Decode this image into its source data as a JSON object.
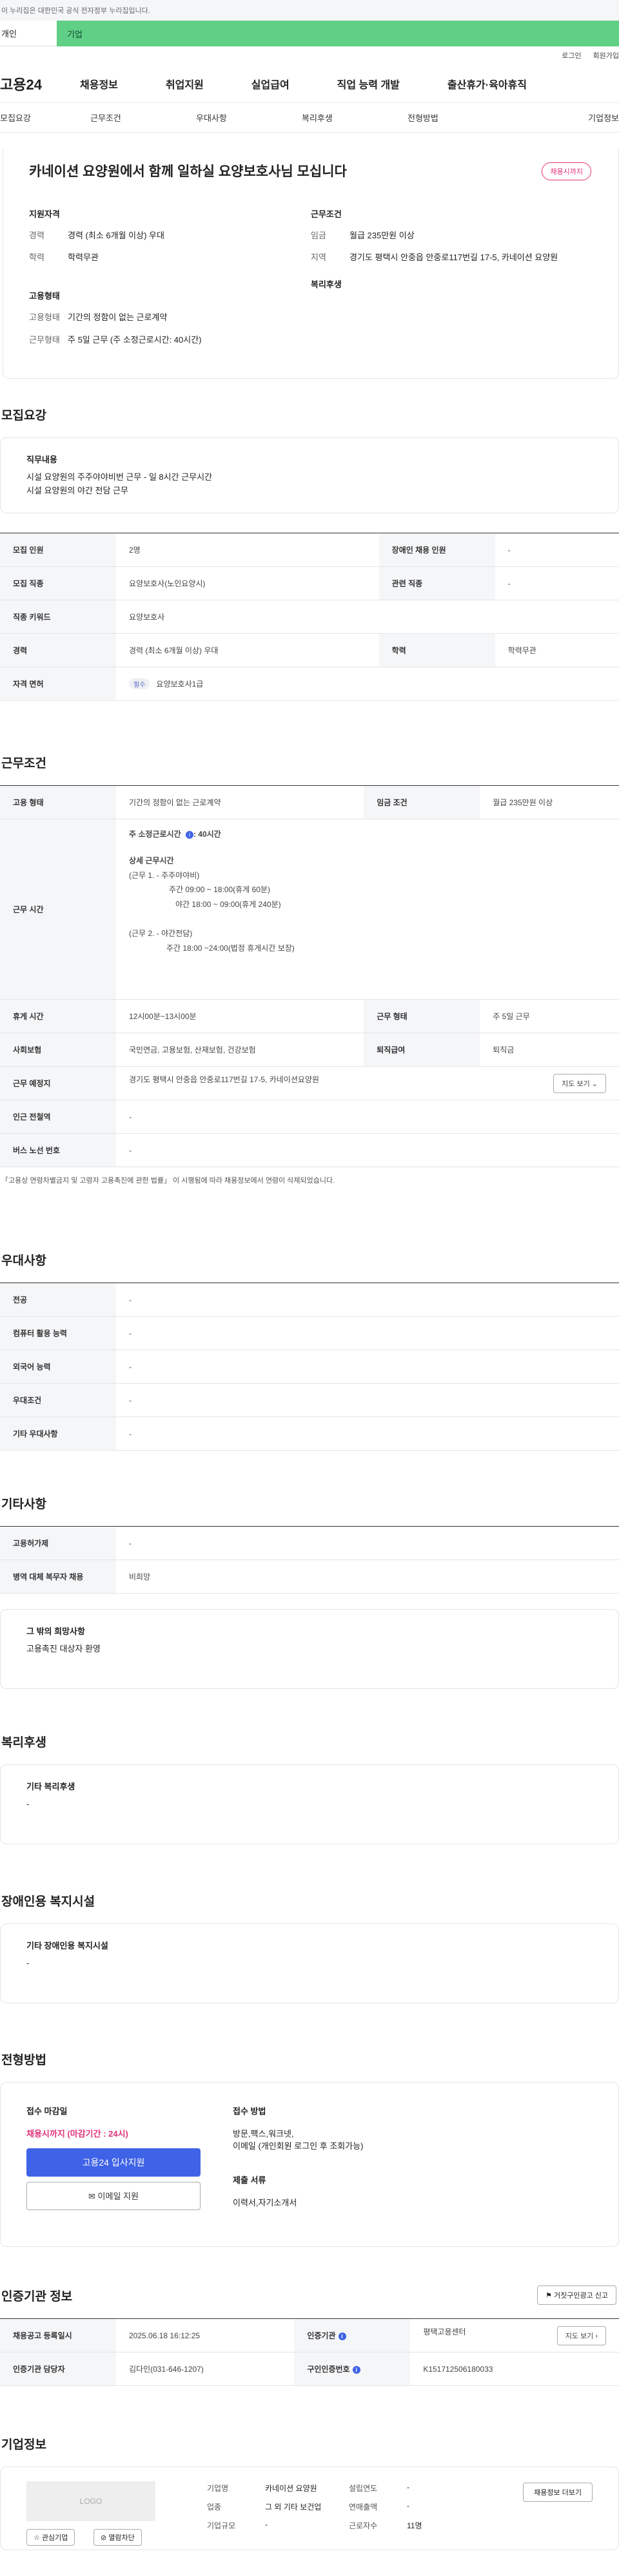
{
  "gov_banner": "이 누리집은 대한민국 공식 전자정부 누리집입니다.",
  "tabs": {
    "individual": "개인",
    "corporate": "기업"
  },
  "util": {
    "login": "로그인",
    "join": "회원가입"
  },
  "gnb": {
    "logo": "고용24",
    "items": [
      "채용정보",
      "취업지원",
      "실업급여",
      "직업 능력 개발",
      "출산휴가·육아휴직"
    ]
  },
  "anchors": [
    "모집요강",
    "근무조건",
    "우대사항",
    "복리후생",
    "전형방법",
    "기업정보"
  ],
  "summary": {
    "title": "카네이션 요양원에서 함께 일하실 요양보호사님 모십니다",
    "badge": "채용시까지",
    "qual_h": "지원자격",
    "career_k": "경력",
    "career_v": "경력 (최소 6개월 이상) 우대",
    "edu_k": "학력",
    "edu_v": "학력무관",
    "cond_h": "근무조건",
    "wage_k": "임금",
    "wage_v": "월급 235만원 이상",
    "region_k": "지역",
    "region_v": "경기도 평택시 안중읍 안중로117번길 17-5, 카네이션 요양원",
    "emp_h": "고용형태",
    "emp_k": "고용형태",
    "emp_v": "기간의 정함이 없는 근로계약",
    "work_k": "근무형태",
    "work_v": "주 5일 근무 (주 소정근로시간: 40시간)",
    "welfare_h": "복리후생"
  },
  "recruit": {
    "title": "모집요강",
    "duty_h": "직무내용",
    "duty_lines": [
      "시설 요양원의 주주야야비번 근무 - 일 8시간 근무시간",
      "시설 요양원의 야간 전담 근무"
    ],
    "rows": [
      [
        "모집 인원",
        "2명",
        "장애인 채용 인원",
        "-"
      ],
      [
        "모집 직종",
        "요양보호사(노인요양시)",
        "관련 직종",
        "-"
      ],
      [
        "직종 키워드",
        "요양보호사",
        "",
        ""
      ],
      [
        "경력",
        "경력 (최소 6개월 이상) 우대",
        "학력",
        "학력무관"
      ]
    ],
    "license_k": "자격 면허",
    "license_pill": "필수",
    "license_v": "요양보호사1급"
  },
  "work": {
    "title": "근무조건",
    "emp_k": "고용 형태",
    "emp_v": "기간의 정함이 없는 근로계약",
    "wage_k": "임금 조건",
    "wage_v": "월급 235만원 이상",
    "hours_k": "근무 시간",
    "hours_main": "주 소정근로시간",
    "hours_main_v": ": 40시간",
    "detail_h": "상세 근무시간",
    "detail_lines": [
      "(근무 1. - 주주야야비)",
      "주간 09:00 ~ 18:00(휴게 60분)",
      "야간 18:00 ~ 09:00(휴게 240분)",
      "",
      "(근무 2. - 야간전담)",
      "주간 18:00 ~24:00(법정 휴게시간 보장)"
    ],
    "break_k": "휴게 시간",
    "break_v": "12시00분~13시00분",
    "form_k": "근무 형태",
    "form_v": "주 5일 근무",
    "ins_k": "사회보험",
    "ins_v": "국민연금, 고용보험, 산재보험, 건강보험",
    "sev_k": "퇴직급여",
    "sev_v": "퇴직금",
    "place_k": "근무 예정지",
    "place_v": "경기도 평택시 안중읍 안중로117번길 17-5, 카네이션요양원",
    "map_btn": "지도 보기",
    "subway_k": "인근 전철역",
    "subway_v": "-",
    "bus_k": "버스 노선 번호",
    "bus_v": "-",
    "note": "「고용상 연령차별금지 및 고령자 고용촉진에 관한 법률」 이 시행됨에 따라 채용정보에서 연령이 삭제되었습니다."
  },
  "pref": {
    "title": "우대사항",
    "rows": [
      [
        "전공",
        "-"
      ],
      [
        "컴퓨터 활용 능력",
        "-"
      ],
      [
        "외국어 능력",
        "-"
      ],
      [
        "우대조건",
        "-"
      ],
      [
        "기타 우대사항",
        "-"
      ]
    ]
  },
  "etc": {
    "title": "기타사항",
    "rows": [
      [
        "고용허가제",
        "-"
      ],
      [
        "병역 대체 복무자 채용",
        "비희망"
      ]
    ],
    "hope_h": "그 밖의 희망사항",
    "hope_v": "고용촉진 대상자 환영"
  },
  "welfare": {
    "title": "복리후생",
    "h": "기타 복리후생",
    "v": "-"
  },
  "disabled": {
    "title": "장애인용 복지시설",
    "h": "기타 장애인용 복지시설",
    "v": "-"
  },
  "process": {
    "title": "전형방법",
    "deadline_h": "접수 마감일",
    "deadline_v": "채용시까지 (마감기간 : 24시)",
    "apply_btn": "고용24 입사지원",
    "email_btn": "이메일 지원",
    "method_h": "접수 방법",
    "method_lines": [
      "방문,팩스,워크넷,",
      "이메일 (개인회원 로그인 후 조회가능)"
    ],
    "docs_h": "제출 서류",
    "docs_v": "이력서,자기소개서"
  },
  "cert": {
    "title": "인증기관 정보",
    "report_btn": "거짓구인광고 신고",
    "date_k": "채용공고 등록일시",
    "date_v": "2025.06.18 16:12:25",
    "org_k": "인증기관",
    "org_v": "평택고용센터",
    "map_btn": "지도 보기",
    "mgr_k": "인증기관 담당자",
    "mgr_v": "김다인(031-646-1207)",
    "no_k": "구인인증번호",
    "no_v": "K151712506180033"
  },
  "company": {
    "title": "기업정보",
    "logo": "LOGO",
    "fav_btn": "관심기업",
    "block_btn": "열람차단",
    "info_btn": "채용정보 더보기",
    "name_k": "기업명",
    "name_v": "카네이션 요양원",
    "year_k": "설립연도",
    "year_v": "-",
    "ind_k": "업종",
    "ind_v": "그 외 기타 보건업",
    "sales_k": "연매출액",
    "sales_v": "-",
    "size_k": "기업규모",
    "size_v": "-",
    "emp_k": "근로자수",
    "emp_v": "11명"
  }
}
